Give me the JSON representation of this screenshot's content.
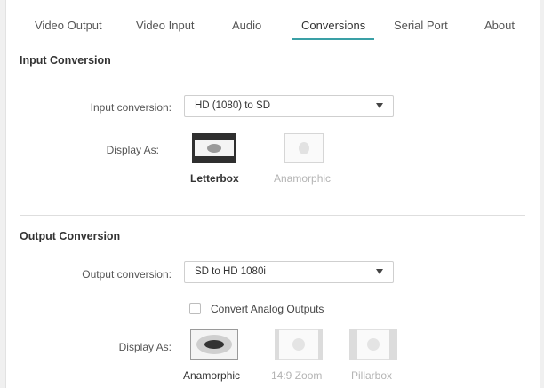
{
  "tabs": [
    {
      "label": "Video Output"
    },
    {
      "label": "Video Input"
    },
    {
      "label": "Audio"
    },
    {
      "label": "Conversions",
      "active": true
    },
    {
      "label": "Serial Port"
    },
    {
      "label": "About"
    }
  ],
  "input_conversion": {
    "section_title": "Input Conversion",
    "select_label": "Input conversion:",
    "select_value": "HD (1080) to SD",
    "display_label": "Display As:",
    "options": [
      {
        "label": "Letterbox",
        "selected": true
      },
      {
        "label": "Anamorphic",
        "selected": false
      }
    ]
  },
  "output_conversion": {
    "section_title": "Output Conversion",
    "select_label": "Output conversion:",
    "select_value": "SD to HD 1080i",
    "checkbox_label": "Convert Analog Outputs",
    "checkbox_checked": false,
    "display_label": "Display As:",
    "options": [
      {
        "label": "Anamorphic",
        "selected": true
      },
      {
        "label": "14:9 Zoom",
        "selected": false
      },
      {
        "label": "Pillarbox",
        "selected": false
      }
    ]
  },
  "colors": {
    "accent": "#3aa0a6",
    "selected_icon": "#333333",
    "dim_icon": "#d6d6d6"
  }
}
